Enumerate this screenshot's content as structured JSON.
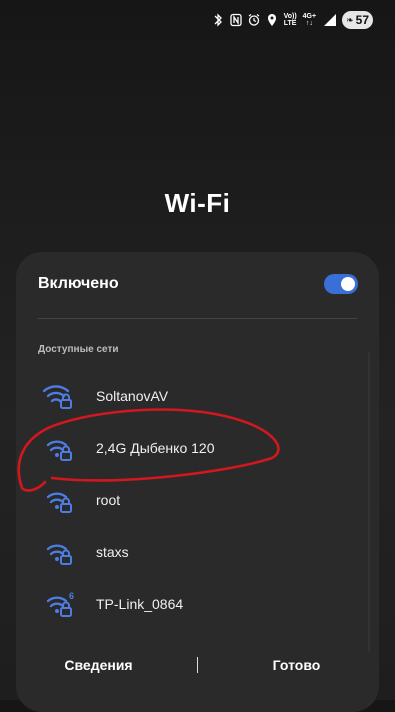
{
  "status_bar": {
    "network_type_top": "Vo))",
    "network_type_bottom": "LTE",
    "signal_label": "4G+",
    "battery_level": "57",
    "icons": [
      "bluetooth-icon",
      "nfc-icon",
      "alarm-icon",
      "location-icon",
      "signal-icon",
      "battery-icon"
    ]
  },
  "page": {
    "title": "Wi-Fi"
  },
  "toggle": {
    "label": "Включено",
    "state": "on",
    "accent": "#3a6fd8"
  },
  "available": {
    "section_label": "Доступные сети",
    "networks": [
      {
        "name": "SoltanovAV",
        "secured": true,
        "wifi6": false
      },
      {
        "name": "2,4G Дыбенко 120",
        "secured": true,
        "wifi6": false
      },
      {
        "name": "root",
        "secured": true,
        "wifi6": false
      },
      {
        "name": "staxs",
        "secured": true,
        "wifi6": false
      },
      {
        "name": "TP-Link_0864",
        "secured": true,
        "wifi6": true,
        "badge": "6"
      }
    ]
  },
  "bottom": {
    "details_label": "Сведения",
    "done_label": "Готово"
  },
  "annotation_color": "#d0181e"
}
